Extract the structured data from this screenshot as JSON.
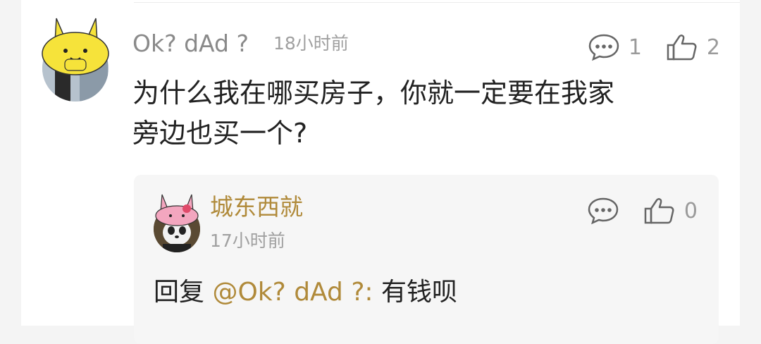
{
  "comment": {
    "username": "Ok? dAd ?",
    "timestamp": "18小时前",
    "reply_count": "1",
    "like_count": "2",
    "text_line1": "为什么我在哪买房子，你就一定要在我家",
    "text_line2": "旁边也买一个?"
  },
  "reply": {
    "username": "城东西就",
    "timestamp": "17小时前",
    "like_count": "0",
    "prefix": "回复 ",
    "mention": "@Ok? dAd ?:",
    "text": " 有钱呗"
  },
  "colors": {
    "username_gray": "#8a8a8a",
    "reply_gold": "#b08a3a",
    "icon_gray": "#666666"
  },
  "icons": [
    "comment-bubble-icon",
    "thumbs-up-icon"
  ]
}
